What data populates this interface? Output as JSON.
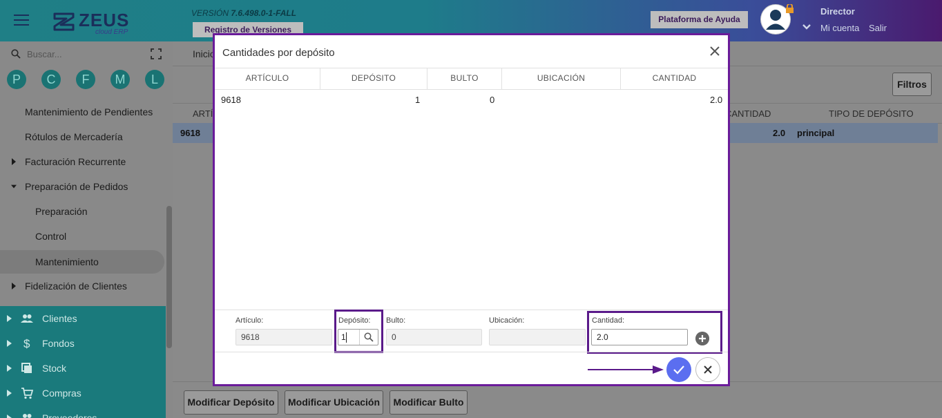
{
  "header": {
    "version_prefix": "VERSIÓN",
    "version_number": "7.6.498.0-1-FALL",
    "registry_button": "Registro de Versiones",
    "help_button": "Plataforma de Ayuda",
    "user_role": "Director",
    "my_account": "Mi cuenta",
    "logout": "Salir",
    "logo_text": "ZEUS",
    "logo_sub": "cloud ERP"
  },
  "sidebar": {
    "search_placeholder": "Buscar...",
    "shortcuts": [
      "P",
      "C",
      "F",
      "M",
      "L"
    ],
    "items": [
      {
        "label": "Mantenimiento de Pendientes"
      },
      {
        "label": "Rótulos de Mercadería"
      },
      {
        "label": "Facturación Recurrente"
      },
      {
        "label": "Preparación de Pedidos"
      },
      {
        "label": "Preparación"
      },
      {
        "label": "Control"
      },
      {
        "label": "Mantenimiento"
      },
      {
        "label": "Fidelización de Clientes"
      }
    ],
    "modules": [
      {
        "label": "Clientes",
        "icon": "people-icon"
      },
      {
        "label": "Fondos",
        "icon": "dollar-icon"
      },
      {
        "label": "Stock",
        "icon": "stack-icon"
      },
      {
        "label": "Compras",
        "icon": "cart-icon"
      },
      {
        "label": "Proveedores",
        "icon": "people-icon"
      }
    ]
  },
  "background": {
    "tab": "Inicio",
    "filter_button": "Filtros",
    "columns": [
      "ARTÍ",
      "CANTIDAD",
      "TIPO DE DEPÓSITO"
    ],
    "row": {
      "article": "9618",
      "quantity": "2.0",
      "deposit_type": "principal"
    },
    "bottom_buttons": [
      "Modificar Depósito",
      "Modificar Ubicación",
      "Modificar Bulto"
    ]
  },
  "modal": {
    "title": "Cantidades por depósito",
    "columns": [
      "ARTÍCULO",
      "DEPÓSITO",
      "BULTO",
      "UBICACIÓN",
      "CANTIDAD"
    ],
    "rows": [
      {
        "articulo": "9618",
        "deposito": "1",
        "bulto": "0",
        "ubicacion": "",
        "cantidad": "2.0"
      }
    ],
    "form": {
      "articulo_label": "Artículo:",
      "articulo_value": "9618",
      "deposito_label": "Depósito:",
      "deposito_value": "1",
      "bulto_label": "Bulto:",
      "bulto_value": "0",
      "ubicacion_label": "Ubicación:",
      "ubicacion_value": "",
      "cantidad_label": "Cantidad:",
      "cantidad_value": "2.0"
    }
  },
  "colors": {
    "modal_border": "#6a1b9a",
    "confirm": "#5b6ef0",
    "sidebar_teal": "#1a7a7c"
  }
}
